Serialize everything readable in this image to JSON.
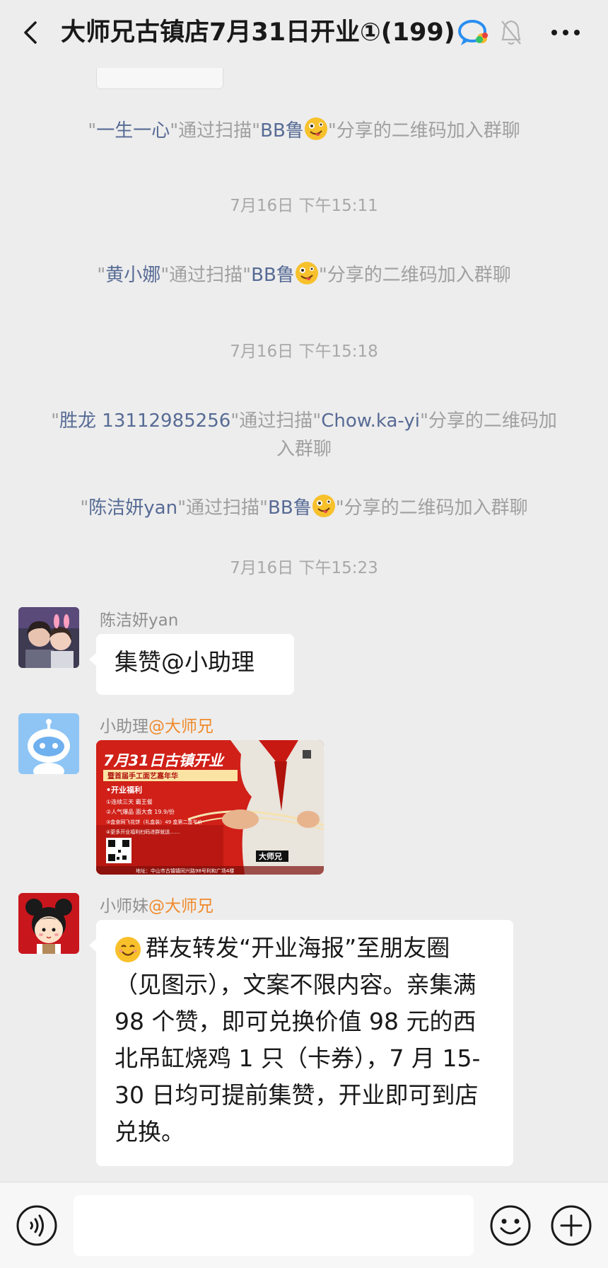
{
  "header": {
    "title": "大师兄古镇店7月31日开业①(199)"
  },
  "notices": [
    {
      "quote": "\"",
      "name": "一生一心",
      "mid": "\"通过扫描\"",
      "sharer": "BB鲁",
      "tail": "\"分享的二维码加入群聊"
    },
    {
      "quote": "\"",
      "name": "黄小娜",
      "mid": "\"通过扫描\"",
      "sharer": "BB鲁",
      "tail": "\"分享的二维码加入群聊"
    },
    {
      "quote": "\"",
      "name": "胜龙 13112985256",
      "mid": "\"通过扫描\"",
      "sharer": "Chow.ka-yi",
      "tail": "\"分享的二维码加入群聊"
    },
    {
      "quote": "\"",
      "name": "陈洁妍yan",
      "mid": "\"通过扫描\"",
      "sharer": "BB鲁",
      "tail": "\"分享的二维码加入群聊"
    }
  ],
  "timestamps": [
    "7月16日 下午15:11",
    "7月16日 下午15:18",
    "7月16日 下午15:23"
  ],
  "messages": [
    {
      "sender": "陈洁妍yan",
      "tag": "",
      "text": "集赞@小助理"
    },
    {
      "sender": "小助理",
      "tag": "@大师兄",
      "text": ""
    },
    {
      "sender": "小师妹",
      "tag": "@大师兄",
      "text": "群友转发“开业海报”至朋友圈（见图示），文案不限内容。亲集满 98 个赞，即可兑换价值 98 元的西北吊缸烧鸡 1 只（卡券），7 月 15-30 日均可提前集赞，开业即可到店兑换。"
    }
  ],
  "poster": {
    "headline": "7月31日古镇开业",
    "subhead": "暨首届手工面艺嘉年华",
    "section": "•开业福利",
    "items": [
      "①连续三天 霸王餐",
      "②人气爆品 面大食 19.9/份",
      "③盒食网飞花饼（礼盒装）49 盒第二盒半价",
      "④更多开业福利扫码进群就送……"
    ],
    "brand": "大师兄",
    "address": "地址：中山市古镇镇同兴路98号利和广场4楼"
  },
  "colors": {
    "background": "#ededed",
    "name_link": "#576b95",
    "tag_orange": "#f08a2c",
    "poster_red": "#d8231c"
  },
  "input": {
    "placeholder": ""
  }
}
